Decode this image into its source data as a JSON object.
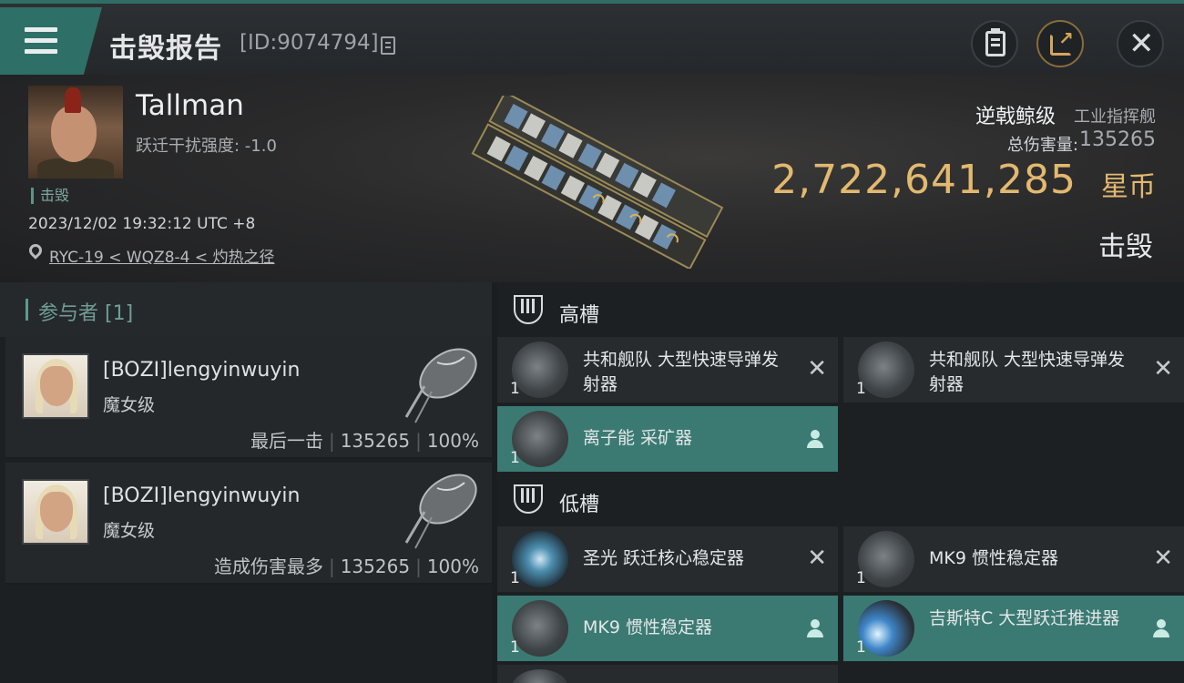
{
  "header": {
    "title": "击毁报告",
    "kill_id": "[ID:9074794]",
    "icons": [
      "menu-icon",
      "copy-icon",
      "clipboard-icon",
      "share-icon",
      "close-icon"
    ]
  },
  "victim": {
    "name": "Tallman",
    "scramble_label": "跃迁干扰强度: -1.0",
    "tag": "击毁",
    "datetime": "2023/12/02 19:32:12 UTC +8",
    "location": "RYC-19 < WQZ8-4 < 灼热之径",
    "ship_class": "逆戟鲸级",
    "ship_group": "工业指挥舰",
    "damage_label": "总伤害量:",
    "damage_value": "135265",
    "isk_value": "2,722,641,285",
    "isk_unit": "星币",
    "status": "击毁"
  },
  "participants": {
    "header": "参与者 [1]",
    "items": [
      {
        "name": "[BOZI]lengyinwuyin",
        "ship": "魔女级",
        "role": "最后一击",
        "damage": "135265",
        "percent": "100%"
      },
      {
        "name": "[BOZI]lengyinwuyin",
        "ship": "魔女级",
        "role": "造成伤害最多",
        "damage": "135265",
        "percent": "100%"
      }
    ]
  },
  "fitting": {
    "high_slots": {
      "title": "高槽",
      "modules": [
        {
          "name": "共和舰队 大型快速导弹发射器",
          "qty": "1",
          "status": "destroyed"
        },
        {
          "name": "共和舰队 大型快速导弹发射器",
          "qty": "1",
          "status": "destroyed"
        },
        {
          "name": "离子能 采矿器",
          "qty": "1",
          "status": "dropped"
        }
      ]
    },
    "low_slots": {
      "title": "低槽",
      "modules": [
        {
          "name": "圣光 跃迁核心稳定器",
          "qty": "1",
          "status": "destroyed"
        },
        {
          "name": "MK9 惯性稳定器",
          "qty": "1",
          "status": "destroyed"
        },
        {
          "name": "MK9 惯性稳定器",
          "qty": "1",
          "status": "dropped"
        },
        {
          "name": "吉斯特C 大型跃迁推进器",
          "qty": "1",
          "status": "dropped"
        }
      ]
    }
  },
  "colors": {
    "accent_teal": "#2e6f68",
    "isk_gold": "#e3b96f",
    "dropped_bg": "#3a7a72",
    "destroyed_bg": "#272b2e"
  }
}
